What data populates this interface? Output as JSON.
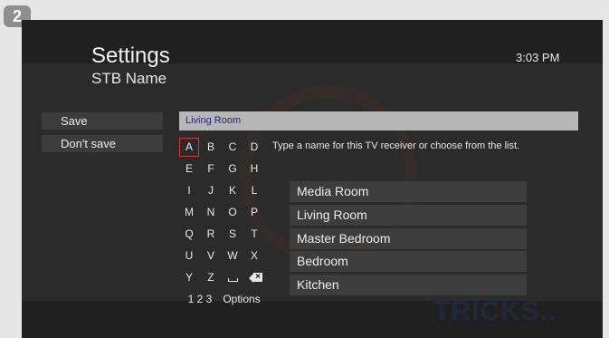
{
  "step_badge": "2",
  "header": {
    "title": "Settings",
    "subtitle": "STB Name",
    "time": "3:03 PM"
  },
  "menu": {
    "save_label": "Save",
    "dont_save_label": "Don't save"
  },
  "name_field": {
    "value": "Living Room"
  },
  "hint_text": "Type a name for this TV receiver or choose from the list.",
  "keyboard": {
    "rows": [
      [
        "A",
        "B",
        "C",
        "D"
      ],
      [
        "E",
        "F",
        "G",
        "H"
      ],
      [
        "I",
        "J",
        "K",
        "L"
      ],
      [
        "M",
        "N",
        "O",
        "P"
      ],
      [
        "Q",
        "R",
        "S",
        "T"
      ],
      [
        "U",
        "V",
        "W",
        "X"
      ],
      [
        "Y",
        "Z",
        "space-icon",
        "backspace-icon"
      ]
    ],
    "selected_key": "A",
    "numbers_label": "1 2 3",
    "options_label": "Options"
  },
  "suggestions": [
    "Media Room",
    "Living Room",
    "Master Bedroom",
    "Bedroom",
    "Kitchen"
  ],
  "watermark_text": "TRICKS.."
}
